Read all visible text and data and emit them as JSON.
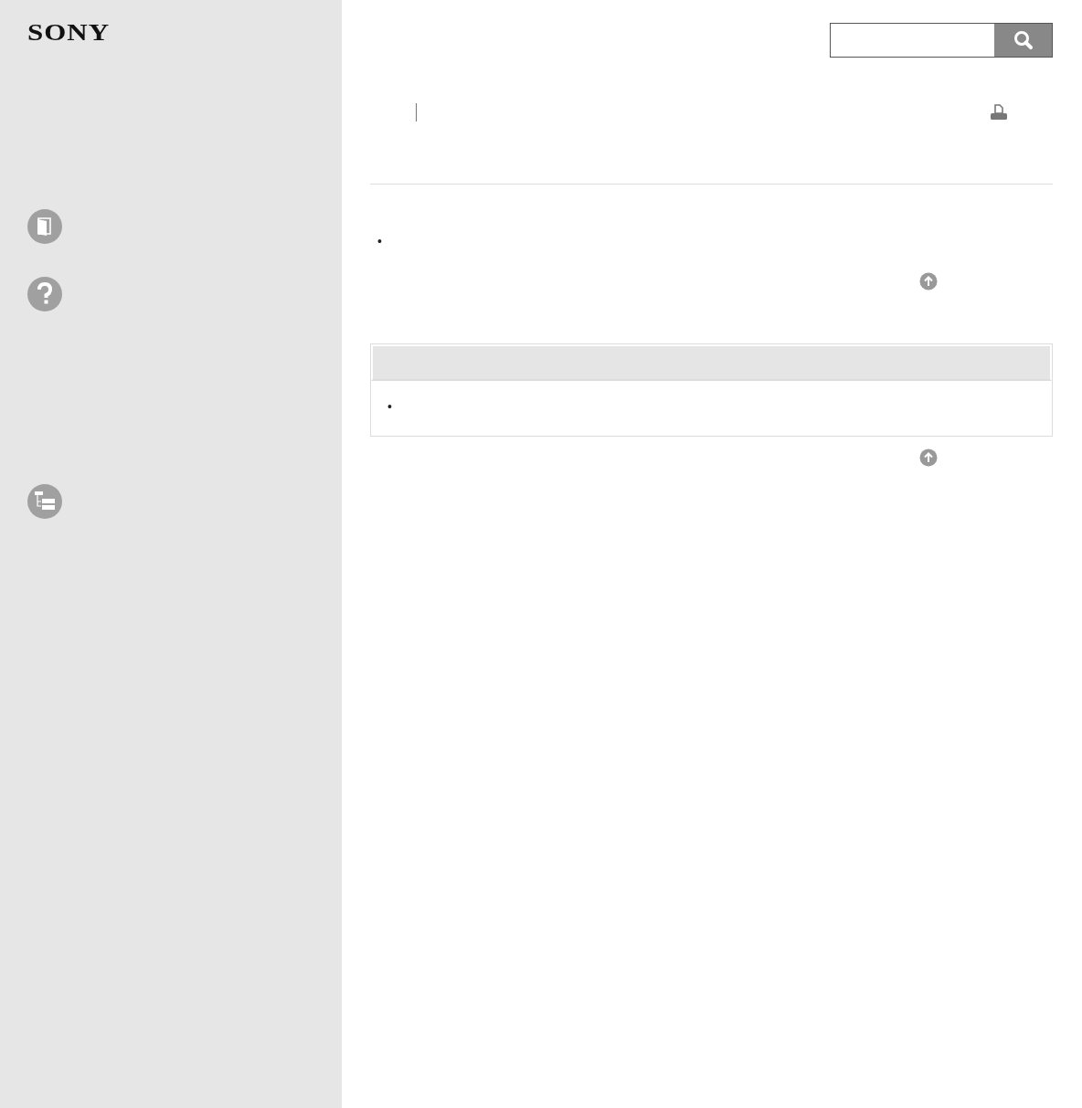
{
  "logo": "SONY",
  "sidebar": {
    "items": [
      {
        "kind": "book"
      },
      {
        "kind": "help"
      },
      {
        "kind": "tree"
      }
    ]
  },
  "content": {
    "bullets": [
      "•"
    ],
    "note_table": {
      "bullets": [
        "•"
      ]
    }
  }
}
